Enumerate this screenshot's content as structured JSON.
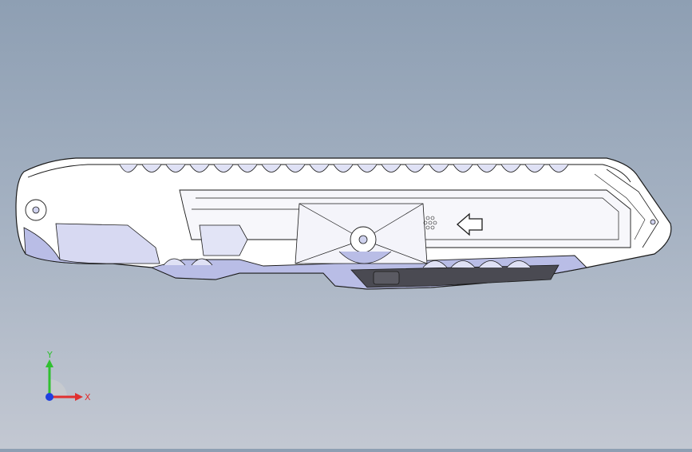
{
  "viewport": {
    "background_top": "#8e9fb3",
    "background_bottom": "#c3c8d2",
    "part": {
      "name": "utility-knife-housing",
      "edge_color": "#1a1a1a",
      "face_color": "#ffffff",
      "shade_color": "#b9bde6",
      "dark_color": "#4a4a52",
      "direction_arrow": "arrow-left-icon"
    }
  },
  "triad": {
    "x_label": "X",
    "y_label": "Y",
    "x_color": "#e03030",
    "y_color": "#30c030",
    "z_color": "#2040e0"
  }
}
